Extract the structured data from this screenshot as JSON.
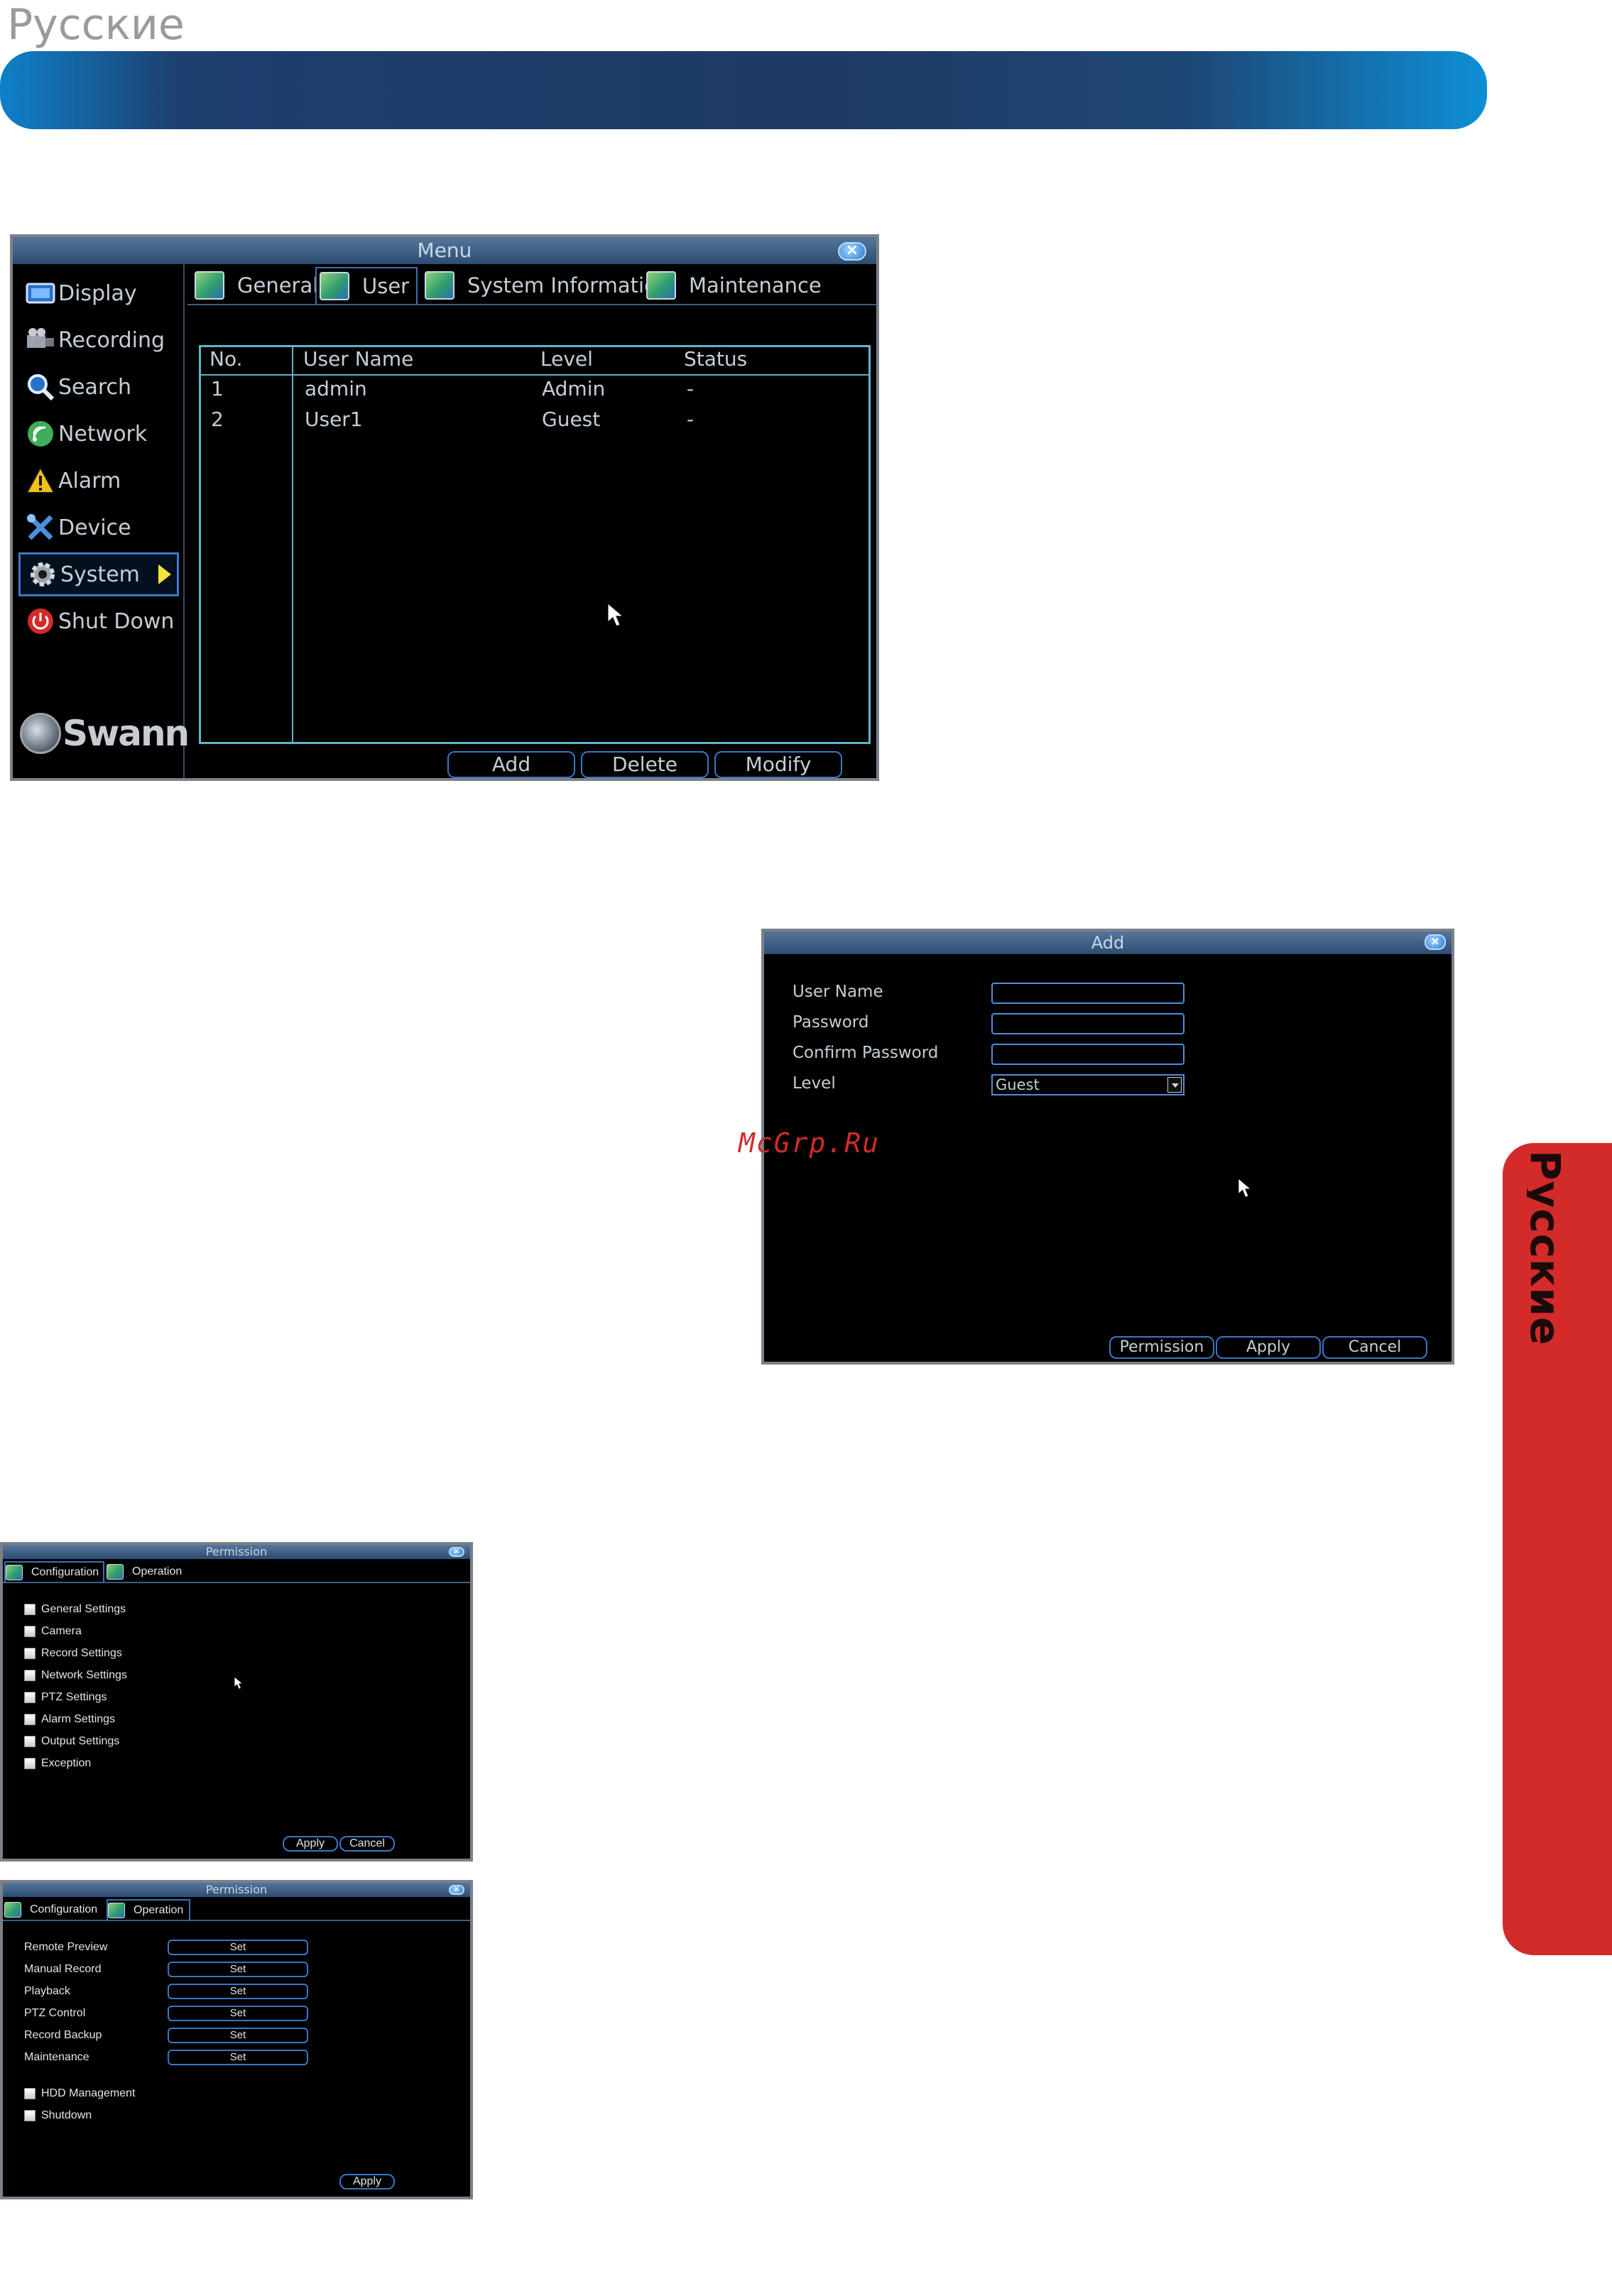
{
  "page": {
    "heading": "Русские",
    "side_tab_text": "Русские",
    "watermark": "McGrp.Ru"
  },
  "colors": {
    "banner_start": "#0f80c8",
    "banner_mid": "#1f3a64",
    "side_tab": "#d32a2a",
    "dvr_accent": "#3a76c4",
    "table_border": "#5fb5c6"
  },
  "menu_window": {
    "title": "Menu",
    "close_icon": "close-icon",
    "sidebar": [
      {
        "label": "Display",
        "icon": "display-icon"
      },
      {
        "label": "Recording",
        "icon": "recording-icon"
      },
      {
        "label": "Search",
        "icon": "search-icon"
      },
      {
        "label": "Network",
        "icon": "network-icon"
      },
      {
        "label": "Alarm",
        "icon": "alarm-icon"
      },
      {
        "label": "Device",
        "icon": "device-icon"
      },
      {
        "label": "System",
        "icon": "gear-icon",
        "active": true
      },
      {
        "label": "Shut Down",
        "icon": "power-icon"
      }
    ],
    "logo": "Swann",
    "tabs": [
      "General",
      "User",
      "System Information",
      "Maintenance"
    ],
    "active_tab": "User",
    "table": {
      "headers": [
        "No.",
        "User Name",
        "Level",
        "Status"
      ],
      "rows": [
        [
          "1",
          "admin",
          "Admin",
          "-"
        ],
        [
          "2",
          "User1",
          "Guest",
          "-"
        ]
      ]
    },
    "buttons": {
      "add": "Add",
      "delete": "Delete",
      "modify": "Modify"
    }
  },
  "add_window": {
    "title": "Add",
    "fields": {
      "user_name": "User Name",
      "password": "Password",
      "confirm_password": "Confirm Password",
      "level": "Level"
    },
    "level_value": "Guest",
    "buttons": {
      "permission": "Permission",
      "apply": "Apply",
      "cancel": "Cancel"
    }
  },
  "permission_config": {
    "title": "Permission",
    "tabs": [
      "Configuration",
      "Operation"
    ],
    "active_tab": "Configuration",
    "items": [
      "General Settings",
      "Camera",
      "Record Settings",
      "Network Settings",
      "PTZ Settings",
      "Alarm Settings",
      "Output Settings",
      "Exception"
    ],
    "buttons": {
      "apply": "Apply",
      "cancel": "Cancel"
    }
  },
  "permission_operation": {
    "title": "Permission",
    "tabs": [
      "Configuration",
      "Operation"
    ],
    "active_tab": "Operation",
    "set_items": [
      "Remote Preview",
      "Manual Record",
      "Playback",
      "PTZ Control",
      "Record Backup",
      "Maintenance"
    ],
    "set_label": "Set",
    "check_items": [
      "HDD Management",
      "Shutdown"
    ],
    "buttons": {
      "apply": "Apply"
    }
  }
}
